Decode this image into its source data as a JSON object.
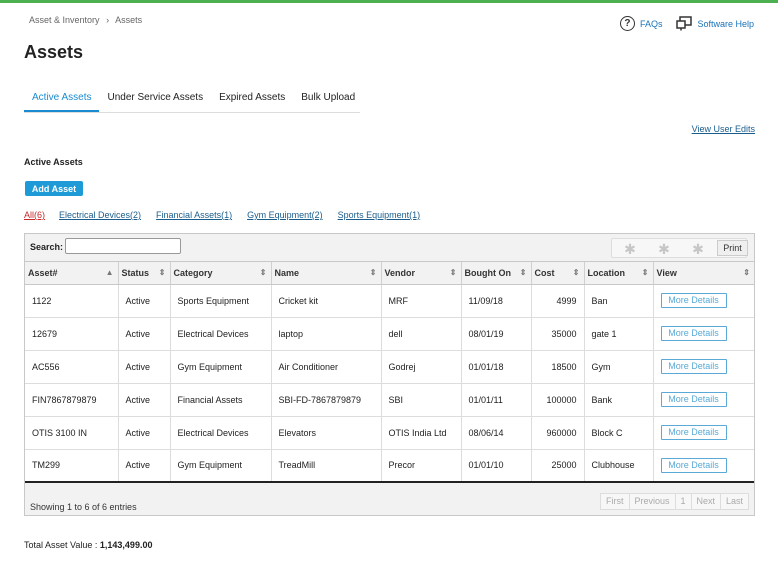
{
  "breadcrumb": {
    "parent": "Asset & Inventory",
    "separator": "›",
    "current": "Assets"
  },
  "help": {
    "faqs": "FAQs",
    "software_help": "Software Help"
  },
  "page_title": "Assets",
  "tabs": [
    {
      "label": "Active Assets",
      "active": true
    },
    {
      "label": "Under Service Assets",
      "active": false
    },
    {
      "label": "Expired Assets",
      "active": false
    },
    {
      "label": "Bulk Upload",
      "active": false
    }
  ],
  "view_user_edits": "View User Edits",
  "section_title": "Active Assets",
  "add_asset_label": "Add Asset",
  "filters": [
    {
      "label": "All(6)"
    },
    {
      "label": "Electrical Devices(2)"
    },
    {
      "label": "Financial Assets(1)"
    },
    {
      "label": "Gym Equipment(2)"
    },
    {
      "label": "Sports Equipment(1)"
    }
  ],
  "search": {
    "label": "Search:",
    "value": ""
  },
  "print_label": "Print",
  "columns": [
    "Asset#",
    "Status",
    "Category",
    "Name",
    "Vendor",
    "Bought On",
    "Cost",
    "Location",
    "View"
  ],
  "rows": [
    [
      "1122",
      "Active",
      "Sports Equipment",
      "Cricket kit",
      "MRF",
      "11/09/18",
      "4999",
      "Ban",
      "More Details"
    ],
    [
      "12679",
      "Active",
      "Electrical Devices",
      "laptop",
      "dell",
      "08/01/19",
      "35000",
      "gate 1",
      "More Details"
    ],
    [
      "AC556",
      "Active",
      "Gym Equipment",
      "Air Conditioner",
      "Godrej",
      "01/01/18",
      "18500",
      "Gym",
      "More Details"
    ],
    [
      "FIN7867879879",
      "Active",
      "Financial Assets",
      "SBI-FD-7867879879",
      "SBI",
      "01/01/11",
      "100000",
      "Bank",
      "More Details"
    ],
    [
      "OTIS 3100 IN",
      "Active",
      "Electrical Devices",
      "Elevators",
      "OTIS India Ltd",
      "08/06/14",
      "960000",
      "Block C",
      "More Details"
    ],
    [
      "TM299",
      "Active",
      "Gym Equipment",
      "TreadMill",
      "Precor",
      "01/01/10",
      "25000",
      "Clubhouse",
      "More Details"
    ]
  ],
  "showing_text": "Showing 1 to 6 of 6 entries",
  "pager": [
    "First",
    "Previous",
    "1",
    "Next",
    "Last"
  ],
  "total": {
    "label": "Total Asset Value :",
    "value": "1,143,499.00"
  },
  "colors": {
    "accent": "#1a8bd1",
    "button": "#1e9ad6",
    "topline": "#4caf50",
    "filter_active": "#c62828"
  }
}
